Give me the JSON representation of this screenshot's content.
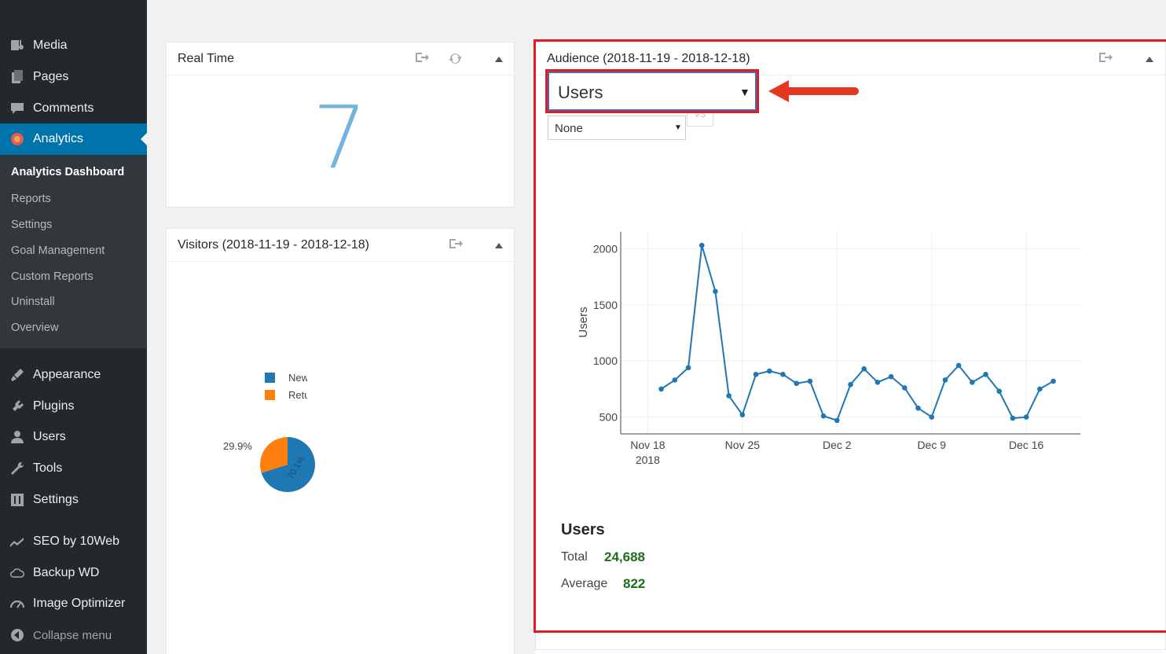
{
  "sidebar": {
    "items": [
      {
        "label": "Media",
        "icon": "media-icon"
      },
      {
        "label": "Pages",
        "icon": "pages-icon"
      },
      {
        "label": "Comments",
        "icon": "comments-icon"
      },
      {
        "label": "Analytics",
        "icon": "analytics-icon"
      },
      {
        "label": "Appearance",
        "icon": "appearance-icon"
      },
      {
        "label": "Plugins",
        "icon": "plugins-icon"
      },
      {
        "label": "Users",
        "icon": "users-icon"
      },
      {
        "label": "Tools",
        "icon": "tools-icon"
      },
      {
        "label": "Settings",
        "icon": "settings-icon"
      },
      {
        "label": "SEO by 10Web",
        "icon": "seo-icon"
      },
      {
        "label": "Backup WD",
        "icon": "cloud-icon"
      },
      {
        "label": "Image Optimizer",
        "icon": "gauge-icon"
      }
    ],
    "submenu": [
      "Analytics Dashboard",
      "Reports",
      "Settings",
      "Goal Management",
      "Custom Reports",
      "Uninstall",
      "Overview"
    ],
    "collapse_label": "Collapse menu",
    "accent_color": "#0073aa"
  },
  "realtime": {
    "title": "Real Time",
    "value": "7"
  },
  "visitors": {
    "title": "Visitors (2018-11-19 - 2018-12-18)",
    "legend": [
      "New",
      "Returning"
    ],
    "colors": [
      "#1f77b4",
      "#ff7f0e"
    ],
    "pie_labels": [
      "70.1%",
      "29.9%"
    ]
  },
  "audience": {
    "title": "Audience (2018-11-19 - 2018-12-18)",
    "metric_select": "Users",
    "compare_select": "None",
    "vs_label": "VS",
    "stats_title": "Users",
    "total_label": "Total",
    "total_value": "24,688",
    "average_label": "Average",
    "average_value": "822"
  },
  "chart_data": [
    {
      "type": "line",
      "title": "",
      "ylabel": "Users",
      "xlabel": "",
      "x": [
        "2018-11-19",
        "2018-11-20",
        "2018-11-21",
        "2018-11-22",
        "2018-11-23",
        "2018-11-24",
        "2018-11-25",
        "2018-11-26",
        "2018-11-27",
        "2018-11-28",
        "2018-11-29",
        "2018-11-30",
        "2018-12-01",
        "2018-12-02",
        "2018-12-03",
        "2018-12-04",
        "2018-12-05",
        "2018-12-06",
        "2018-12-07",
        "2018-12-08",
        "2018-12-09",
        "2018-12-10",
        "2018-12-11",
        "2018-12-12",
        "2018-12-13",
        "2018-12-14",
        "2018-12-15",
        "2018-12-16",
        "2018-12-17",
        "2018-12-18"
      ],
      "values": [
        750,
        830,
        940,
        2030,
        1620,
        690,
        520,
        880,
        910,
        880,
        800,
        820,
        510,
        470,
        790,
        930,
        810,
        860,
        760,
        580,
        500,
        830,
        960,
        810,
        880,
        730,
        490,
        500,
        750,
        820
      ],
      "xticks": [
        {
          "date": "2018-11-18",
          "label": "Nov 18",
          "sub": "2018"
        },
        {
          "date": "2018-11-25",
          "label": "Nov 25",
          "sub": ""
        },
        {
          "date": "2018-12-02",
          "label": "Dec 2",
          "sub": ""
        },
        {
          "date": "2018-12-09",
          "label": "Dec 9",
          "sub": ""
        },
        {
          "date": "2018-12-16",
          "label": "Dec 16",
          "sub": ""
        }
      ],
      "yticks": [
        500,
        1000,
        1500,
        2000
      ],
      "xlim": [
        "2018-11-16",
        "2018-12-20"
      ],
      "ylim": [
        350,
        2150
      ],
      "grid": true,
      "color": "#1f77b4"
    },
    {
      "type": "pie",
      "categories": [
        "New",
        "Returning"
      ],
      "values": [
        70.1,
        29.9
      ],
      "colors": [
        "#1f77b4",
        "#ff7f0e"
      ]
    }
  ]
}
